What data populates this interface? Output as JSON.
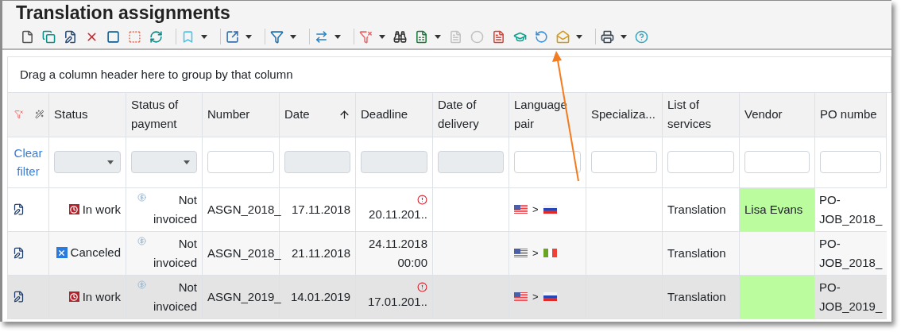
{
  "window": {
    "title": "Translation assignments"
  },
  "toolbar": [
    {
      "kind": "new",
      "disabled": false,
      "dropdown": false
    },
    {
      "kind": "copy",
      "disabled": false,
      "dropdown": false
    },
    {
      "kind": "edit",
      "disabled": false,
      "dropdown": false
    },
    {
      "kind": "delete",
      "disabled": false,
      "dropdown": false
    },
    {
      "kind": "select_all",
      "disabled": false,
      "dropdown": false
    },
    {
      "kind": "deselect",
      "disabled": false,
      "dropdown": false
    },
    {
      "kind": "refresh",
      "disabled": false,
      "dropdown": false
    },
    {
      "kind": "separator"
    },
    {
      "kind": "bookmark",
      "disabled": false,
      "dropdown": true
    },
    {
      "kind": "separator"
    },
    {
      "kind": "export",
      "disabled": false,
      "dropdown": true
    },
    {
      "kind": "separator"
    },
    {
      "kind": "filter",
      "disabled": false,
      "dropdown": true
    },
    {
      "kind": "separator"
    },
    {
      "kind": "swap",
      "disabled": false,
      "dropdown": true
    },
    {
      "kind": "separator"
    },
    {
      "kind": "filter_clear",
      "disabled": false,
      "dropdown": true
    },
    {
      "kind": "find",
      "disabled": false,
      "dropdown": false
    },
    {
      "kind": "excel",
      "disabled": false,
      "dropdown": true
    },
    {
      "kind": "document",
      "disabled": true,
      "dropdown": false
    },
    {
      "kind": "coin",
      "disabled": true,
      "dropdown": false
    },
    {
      "kind": "pdf",
      "disabled": false,
      "dropdown": false
    },
    {
      "kind": "graduate",
      "disabled": false,
      "dropdown": false
    },
    {
      "kind": "undo_cancel",
      "disabled": false,
      "dropdown": false
    },
    {
      "kind": "mail",
      "disabled": false,
      "dropdown": true
    },
    {
      "kind": "separator"
    },
    {
      "kind": "print",
      "disabled": false,
      "dropdown": true
    },
    {
      "kind": "help",
      "disabled": false,
      "dropdown": false
    }
  ],
  "group_panel": {
    "hint": "Drag a column header here to group by that column"
  },
  "table": {
    "clear_filter": "Clear filter",
    "columns": [
      {
        "label": "Status",
        "kind": "select",
        "sorted": false
      },
      {
        "label": "Status of payment",
        "kind": "select",
        "sorted": false
      },
      {
        "label": "Number",
        "kind": "text",
        "sorted": false
      },
      {
        "label": "Date",
        "kind": "date",
        "sorted": true
      },
      {
        "label": "Deadline",
        "kind": "date",
        "sorted": false
      },
      {
        "label": "Date of delivery",
        "kind": "date",
        "sorted": false
      },
      {
        "label": "Language pair",
        "kind": "text",
        "sorted": false
      },
      {
        "label": "Specializa...",
        "kind": "text",
        "sorted": false
      },
      {
        "label": "List of services",
        "kind": "text",
        "sorted": false
      },
      {
        "label": "Vendor",
        "kind": "text",
        "sorted": false
      },
      {
        "label": "PO numbe",
        "kind": "text",
        "sorted": false
      }
    ],
    "rows": [
      {
        "selected": false,
        "status": {
          "kind": "in_work",
          "text": "In work"
        },
        "payment": "Not invoiced",
        "number": "ASGN_2018_",
        "date": "17.11.2018",
        "deadline": {
          "text": "20.11.201..",
          "overdue": true
        },
        "source": {
          "kind": "us"
        },
        "arrow": ">",
        "target": {
          "kind": "ru"
        },
        "services": "Translation",
        "vendor": {
          "text": "Lisa Evans",
          "highlighted": true
        },
        "po_number": "PO-JOB_2018_"
      },
      {
        "selected": false,
        "status": {
          "kind": "canceled",
          "text": "Canceled"
        },
        "payment": "Not invoiced",
        "number": "ASGN_2018_",
        "date": "21.11.2018",
        "deadline": {
          "text": "24.11.2018 00:00",
          "overdue": false
        },
        "source": {
          "kind": "us"
        },
        "arrow": ">",
        "target": {
          "kind": "it"
        },
        "services": "Translation",
        "vendor": {
          "highlighted": false
        },
        "po_number": "PO-JOB_2018_"
      },
      {
        "selected": true,
        "status": {
          "kind": "in_work",
          "text": "In work"
        },
        "payment": "Not invoiced",
        "number": "ASGN_2019_",
        "date": "14.01.2019",
        "deadline": {
          "text": "17.01.201..",
          "overdue": true
        },
        "source": {
          "kind": "us"
        },
        "arrow": ">",
        "target": {
          "kind": "ru"
        },
        "services": "Translation",
        "vendor": {
          "highlighted": true
        },
        "po_number": "PO-JOB_2019_"
      }
    ]
  }
}
